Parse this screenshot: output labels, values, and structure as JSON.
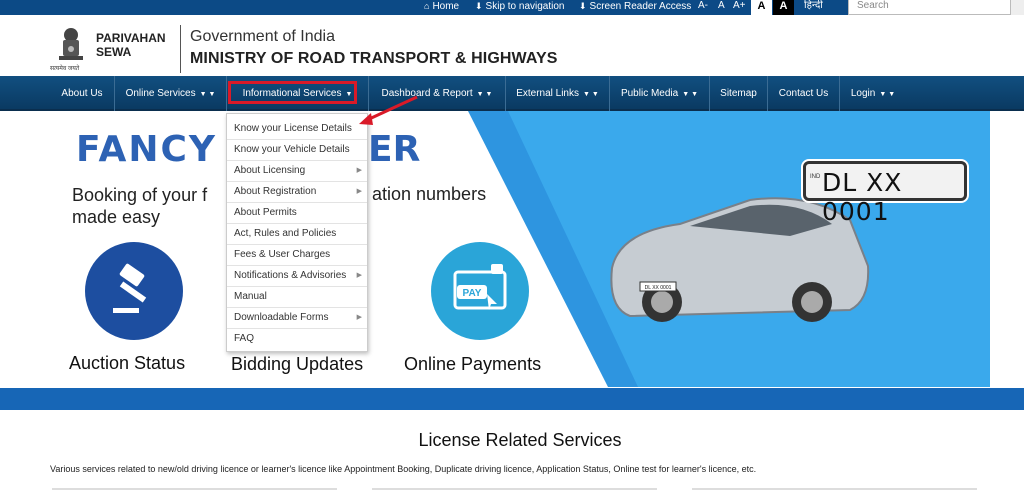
{
  "topbar": {
    "home": "Home",
    "skip": "Skip to navigation",
    "screen_reader": "Screen Reader Access",
    "font_small": "A-",
    "font_normal": "A",
    "font_large": "A+",
    "contrast_light": "A",
    "contrast_dark": "A",
    "language": "हिन्दी",
    "search_placeholder": "Search"
  },
  "header": {
    "brand_line1": "PARIVAHAN",
    "brand_line2": "SEWA",
    "emblem_caption": "सत्यमेव जयते",
    "gov": "Government of India",
    "ministry": "MINISTRY OF ROAD TRANSPORT & HIGHWAYS"
  },
  "nav": {
    "items": [
      {
        "label": "About Us",
        "caret": ""
      },
      {
        "label": "Online Services",
        "caret": "▼ ▼"
      },
      {
        "label": "Informational Services",
        "caret": "▼"
      },
      {
        "label": "Dashboard & Report",
        "caret": "▼ ▼"
      },
      {
        "label": "External Links",
        "caret": "▼ ▼"
      },
      {
        "label": "Public Media",
        "caret": "▼ ▼"
      },
      {
        "label": "Sitemap",
        "caret": ""
      },
      {
        "label": "Contact Us",
        "caret": ""
      },
      {
        "label": "Login",
        "caret": "▼ ▼"
      }
    ]
  },
  "dropdown": {
    "items": [
      {
        "label": "Know your License Details",
        "has_sub": false
      },
      {
        "label": "Know your Vehicle Details",
        "has_sub": false
      },
      {
        "label": "About Licensing",
        "has_sub": true
      },
      {
        "label": "About Registration",
        "has_sub": true
      },
      {
        "label": "About Permits",
        "has_sub": false
      },
      {
        "label": "Act, Rules and Policies",
        "has_sub": false
      },
      {
        "label": "Fees & User Charges",
        "has_sub": false
      },
      {
        "label": "Notifications & Advisories",
        "has_sub": true
      },
      {
        "label": "Manual",
        "has_sub": false
      },
      {
        "label": "Downloadable Forms",
        "has_sub": true
      },
      {
        "label": "FAQ",
        "has_sub": false
      }
    ]
  },
  "hero": {
    "title_left": "FANCY",
    "title_right": "ER",
    "subtitle_left_1": "Booking of your f",
    "subtitle_left_2": "made easy",
    "subtitle_right": "ation numbers",
    "plate_country": "IND",
    "plate_number": "DL XX 0001",
    "car_plate": "DL XX 0001",
    "pay_label": "PAY",
    "features": [
      "Auction Status",
      "Bidding Updates",
      "Online Payments"
    ]
  },
  "section": {
    "title": "License Related Services",
    "description": "Various services related to new/old driving licence or learner's licence like Appointment Booking, Duplicate driving licence, Application Status, Online test for learner's licence, etc."
  },
  "colors": {
    "nav_bg": "#0a3a62",
    "topbar_bg": "#0c4a86",
    "brand_blue": "#2d62b4",
    "highlight_red": "#d91a28",
    "band_blue": "#1766b6"
  }
}
